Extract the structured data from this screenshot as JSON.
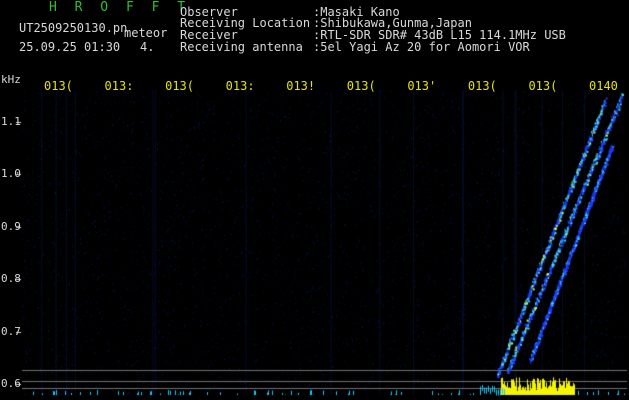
{
  "header": {
    "title": "H R O F F T",
    "filename": "UT2509250130.pn",
    "event_tag": "meteor",
    "datetime": "25.09.25 01:30",
    "index": "4.",
    "meta": [
      {
        "key": "Observer",
        "value": ":Masaki Kano"
      },
      {
        "key": "Receiving Location",
        "value": ":Shibukawa,Gunma,Japan"
      },
      {
        "key": "Receiver",
        "value": ":RTL-SDR SDR# 43dB L15 114.1MHz USB"
      },
      {
        "key": "Receiving antenna",
        "value": ":5el Yagi Az 20 for Aomori VOR"
      }
    ]
  },
  "chart_data": {
    "type": "heatmap",
    "y_unit": "kHz",
    "x_tick_labels": [
      "013(",
      "013:",
      "013(",
      "013:",
      "013!",
      "013(",
      "013'",
      "013(",
      "013(",
      "0140"
    ],
    "y_tick_labels": [
      "1.1",
      "1.0",
      "0.9",
      "0.8",
      "0.7",
      "0.6"
    ],
    "y_ticks": [
      1.1,
      1.0,
      0.9,
      0.8,
      0.7,
      0.6
    ],
    "ylim": [
      0.58,
      1.16
    ],
    "colors": {
      "background": "#000000",
      "noise": "#0a1a5a",
      "signal_low": "#1e3cff",
      "signal_mid": "#37d0ff",
      "signal_high": "#c8ff60",
      "baseline_bars": "#f5f500",
      "baseline_low": "#19c8ff",
      "ticks": "#e6e300",
      "gridline": "#a0a0a0"
    }
  }
}
